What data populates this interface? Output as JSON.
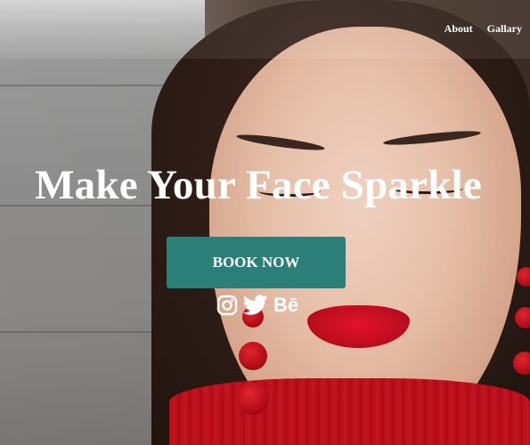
{
  "nav": {
    "items": [
      {
        "label": "About"
      },
      {
        "label": "Gallary"
      }
    ]
  },
  "hero": {
    "headline": "Make Your Face Sparkle",
    "cta_label": "BOOK NOW"
  },
  "social": {
    "icons": [
      "instagram-icon",
      "twitter-icon",
      "behance-icon"
    ],
    "behance_text": "Bē"
  },
  "colors": {
    "cta_background": "#2c7f79",
    "text": "#ffffff"
  }
}
